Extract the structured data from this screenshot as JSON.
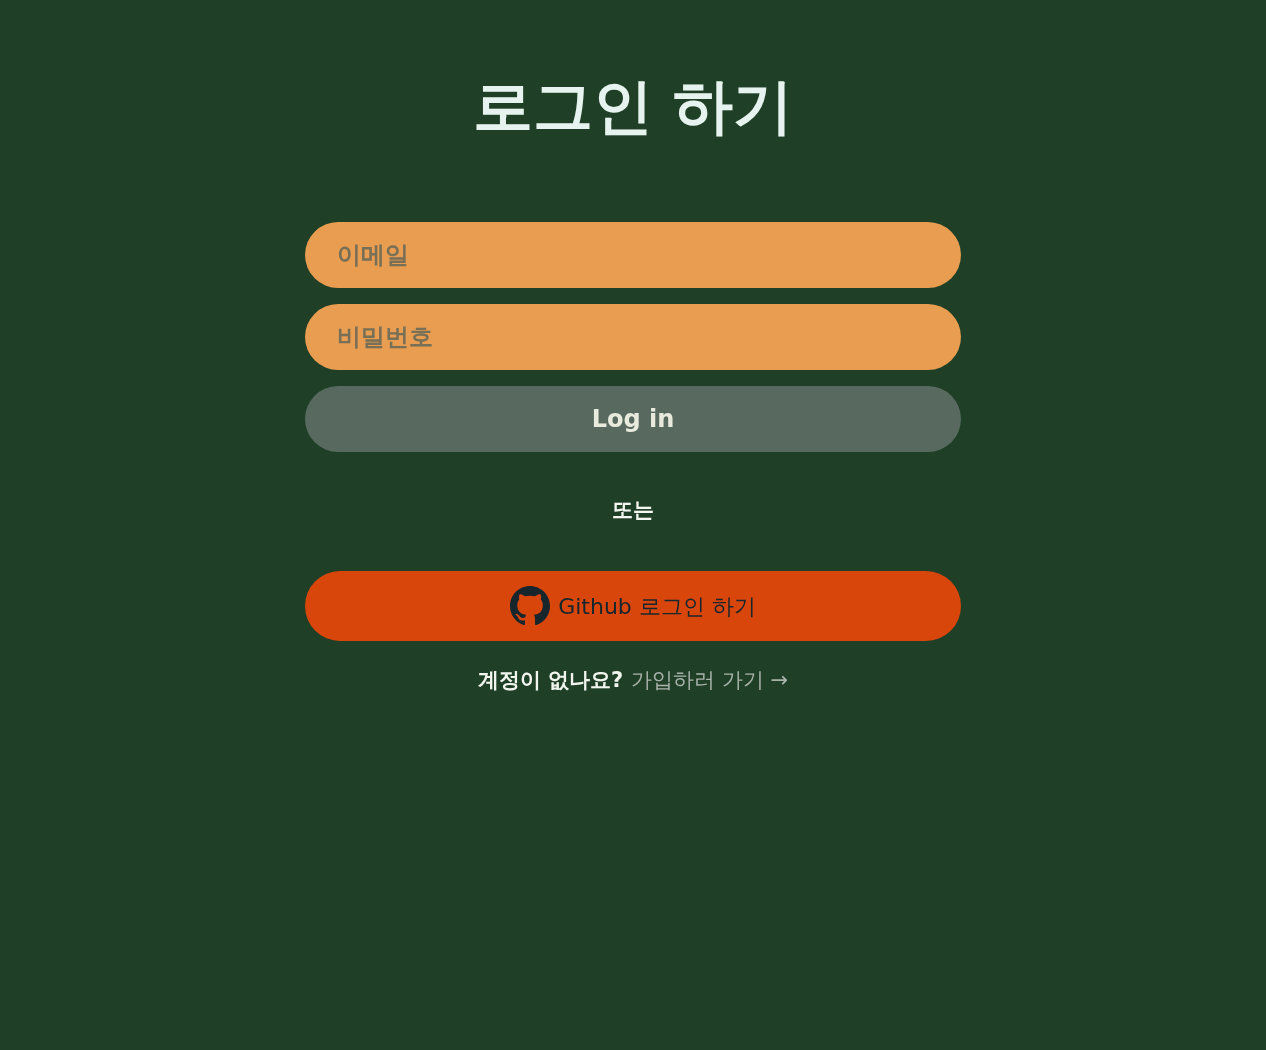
{
  "title": "로그인 하기",
  "form": {
    "email_field": {
      "placeholder": "이메일"
    },
    "password_field": {
      "placeholder": "비밀번호"
    },
    "submit_button": {
      "label": "Log in"
    }
  },
  "divider_text": "또는",
  "github_button": {
    "label": "Github 로그인 하기"
  },
  "signup": {
    "prompt": "계정이 없나요?",
    "link": "가입하러 가기 →"
  }
}
